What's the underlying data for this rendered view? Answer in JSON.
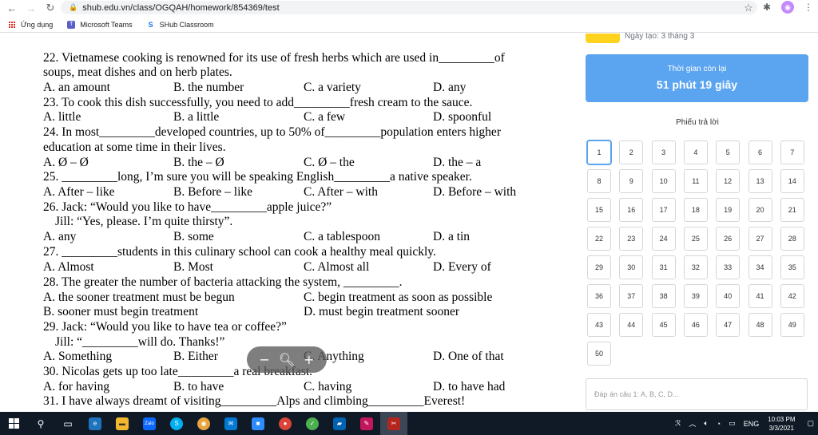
{
  "browser": {
    "url": "shub.edu.vn/class/OGQAH/homework/854369/test",
    "bookmarks": [
      "Ứng dụng",
      "Microsoft Teams",
      "SHub Classroom"
    ]
  },
  "questions": [
    {
      "lines": [
        "22. Vietnamese cooking is renowned for its use of fresh herbs which are used in_________of",
        "soups, meat dishes and on herb plates."
      ],
      "options": [
        "A. an amount",
        "B. the number",
        "C. a variety",
        "D. any"
      ]
    },
    {
      "lines": [
        "23. To cook this dish successfully, you need to add_________fresh cream to the sauce."
      ],
      "options": [
        "A. little",
        "B. a little",
        "C. a few",
        "D. spoonful"
      ]
    },
    {
      "lines": [
        "24. In most_________developed countries, up to 50% of_________population enters higher",
        "education at some time in their lives."
      ],
      "options": [
        "A. Ø – Ø",
        "B. the – Ø",
        "C. Ø – the",
        "D. the – a"
      ]
    },
    {
      "lines": [
        "25. _________long, I’m sure you will be speaking English_________a native speaker."
      ],
      "options": [
        "A. After – like",
        "B. Before – like",
        "C. After – with",
        "D. Before – with"
      ]
    },
    {
      "lines": [
        "26. Jack: “Would you like to have_________apple juice?”",
        "Jill: “Yes, please. I’m quite thirsty”."
      ],
      "options": [
        "A. any",
        "B. some",
        "C. a tablespoon",
        "D. a tin"
      ]
    },
    {
      "lines": [
        "27. _________students in this culinary school can cook a healthy meal quickly."
      ],
      "options": [
        "A. Almost",
        "B. Most",
        "C. Almost all",
        "D. Every of"
      ]
    },
    {
      "lines": [
        "28. The greater the number of bacteria attacking the system, _________."
      ],
      "options2": [
        [
          "A. the sooner treatment must be begun",
          "C. begin treatment as soon as possible"
        ],
        [
          "B. sooner must begin treatment",
          "D. must begin treatment sooner"
        ]
      ]
    },
    {
      "lines": [
        "29. Jack: “Would you like to have tea or coffee?”",
        "Jill: “_________will do. Thanks!”"
      ],
      "options": [
        "A. Something",
        "B. Either",
        "C. Anything",
        "D. One of that"
      ]
    },
    {
      "lines": [
        "30. Nicolas gets up too late_________a real breakfast."
      ],
      "options": [
        "A. for having",
        "B. to have",
        "C. having",
        "D. to have had"
      ]
    },
    {
      "lines": [
        "31. I have always dreamt of visiting_________Alps and climbing_________Everest!"
      ]
    }
  ],
  "panel": {
    "date_text": "Ngày tạo: 3 tháng 3",
    "timer_label": "Thời gian còn lại",
    "timer_value": "51 phút 19 giây",
    "sheet_title": "Phiếu trả lời",
    "answer_placeholder": "Đáp án câu 1: A, B, C, D...",
    "active_question": 1,
    "count": 50
  },
  "taskbar": {
    "time": "10:03 PM",
    "date": "3/3/2021",
    "lang": "ENG"
  },
  "colors": {
    "timer_bg": "#5ba4f0",
    "taskbar_bg": "#101a27",
    "accent_yellow": "#ffd21e"
  }
}
